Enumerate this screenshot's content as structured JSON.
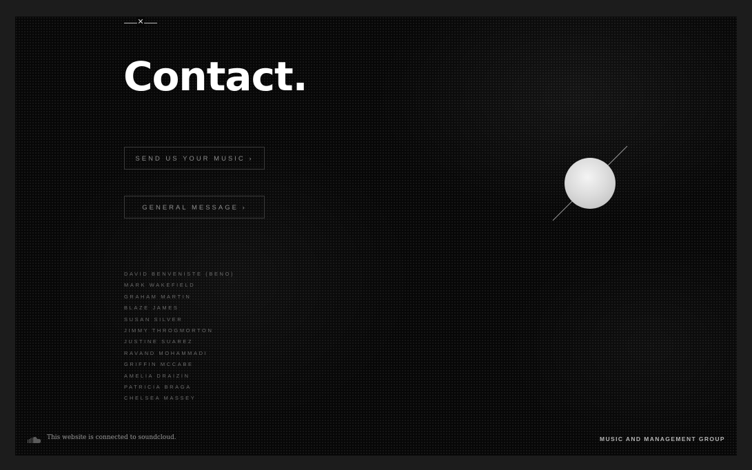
{
  "page": {
    "title": "Contact.",
    "close_icon": "close-icon"
  },
  "buttons": {
    "send_music": "SEND US YOUR MUSIC ›",
    "general_message": "GENERAL MESSAGE ›"
  },
  "people": [
    "DAVID BENVENISTE (BENO)",
    "MARK WAKEFIELD",
    "GRAHAM MARTIN",
    "BLAZE JAMES",
    "SUSAN SILVER",
    "JIMMY THROGMORTON",
    "JUSTINE SUAREZ",
    "RAVAND MOHAMMADI",
    "GRIFFIN MCCABE",
    "AMELIA DRAIZIN",
    "PATRICIA BRAGA",
    "CHELSEA MASSEY"
  ],
  "footer": {
    "icon": "soundcloud-icon",
    "note": "This website is connected to soundcloud.",
    "brand": "MUSIC AND MANAGEMENT GROUP"
  },
  "colors": {
    "background": "#070707",
    "outer_frame": "#1c1c1c",
    "title": "#ffffff",
    "orb": "#dcdcdc"
  }
}
